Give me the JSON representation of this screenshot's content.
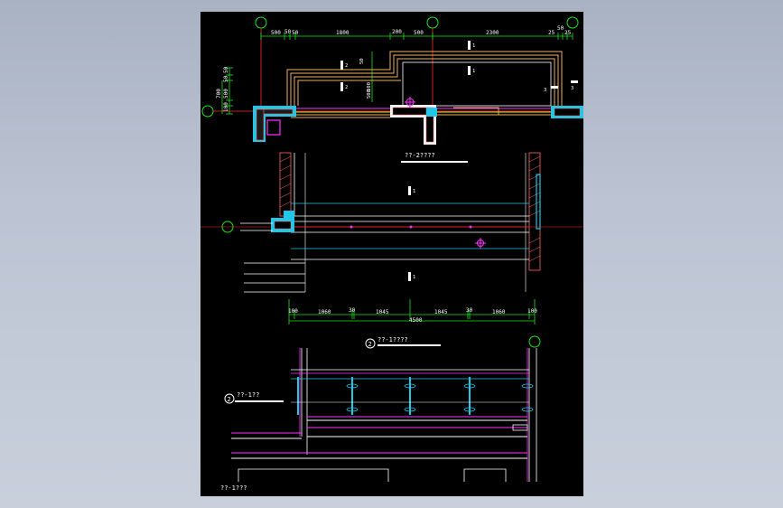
{
  "colors": {
    "background": "#000000",
    "frame": "#a9b2c3",
    "white": "#ffffff",
    "red": "#ff2a2a",
    "green": "#19e619",
    "cyan": "#22c6e6",
    "orange": "#f0b060",
    "magenta": "#ff33ff",
    "yellow": "#e6e619",
    "hatch": "#ff6a6a"
  },
  "plan": {
    "top_dims": [
      "500",
      "50",
      "50",
      "1800",
      "200",
      "500",
      "2300",
      "25",
      "50",
      "25"
    ],
    "left_dims": [
      "50",
      "50",
      "500",
      "100",
      "700"
    ],
    "inner_dims": [
      "100",
      "500",
      "50"
    ],
    "tags": [
      "2",
      "2",
      "1",
      "1",
      "3",
      "3"
    ],
    "title": "??-2????"
  },
  "section": {
    "bottom_dims": [
      "100",
      "1060",
      "30",
      "1045",
      "1045",
      "30",
      "1060",
      "100"
    ],
    "total_dim": "4500",
    "tags": [
      "1",
      "1"
    ],
    "title": "??-1????",
    "callout_number": "2"
  },
  "elevation": {
    "callout_label": "??-1??",
    "callout_number": "2",
    "bottom_label": "??-1???"
  }
}
